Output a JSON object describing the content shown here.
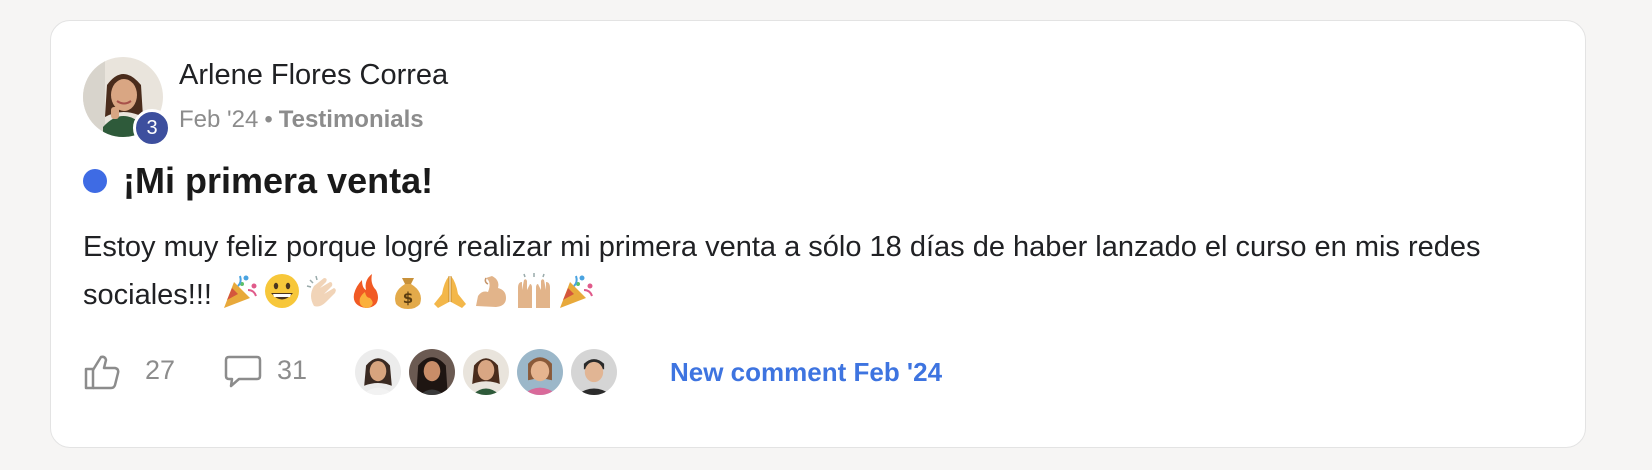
{
  "post": {
    "author": "Arlene Flores Correa",
    "level": "3",
    "date": "Feb '24",
    "separator": "•",
    "category": "Testimonials",
    "title": "¡Mi primera venta!",
    "body": "Estoy muy feliz porque logré realizar mi primera venta a sólo 18 días de haber lanzado el curso en mis redes sociales!!!",
    "emojis": [
      "party-popper",
      "grinning-face",
      "clapping-hands",
      "fire",
      "money-bag",
      "folded-hands",
      "flexed-biceps",
      "raising-hands",
      "party-popper"
    ],
    "unread_dot_color": "#3e6be4",
    "level_badge_color": "#3d4f9e"
  },
  "footer": {
    "like_count": "27",
    "comment_count": "31",
    "commenter_avatars": [
      "commenter-1",
      "commenter-2",
      "commenter-3",
      "commenter-4",
      "commenter-5"
    ],
    "new_comment_text": "New comment Feb '24",
    "link_color": "#3e74e0"
  }
}
